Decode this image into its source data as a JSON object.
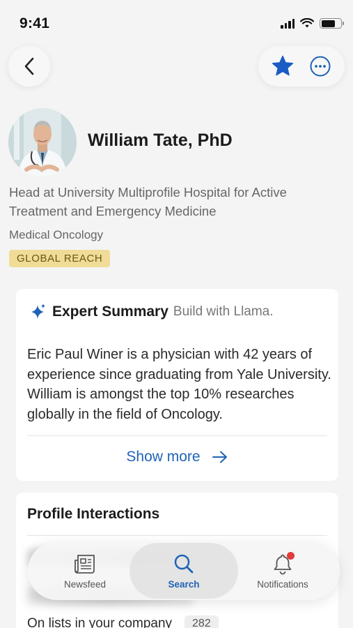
{
  "status_bar": {
    "time": "9:41"
  },
  "nav": {
    "back_icon": "chevron-left-icon",
    "favorite_icon": "star-icon",
    "more_icon": "ellipsis-circle-icon"
  },
  "profile": {
    "name": "William Tate, PhD",
    "title": "Head at University Multiprofile Hospital for Active Treatment and Emergency Medicine",
    "specialty": "Medical Oncology",
    "badge": "GLOBAL REACH"
  },
  "summary": {
    "title": "Expert Summary",
    "subtitle": "Build with Llama.",
    "text": "Eric Paul Winer is a physician with 42 years of experience since graduating from Yale University. William is amongst the top 10% researches globally in the field of Oncology.",
    "show_more": "Show more"
  },
  "interactions": {
    "title": "Profile Interactions",
    "lists_label": "On lists in your company",
    "lists_count": "282"
  },
  "tab_bar": {
    "tabs": [
      {
        "label": "Newsfeed",
        "icon": "newspaper-icon"
      },
      {
        "label": "Search",
        "icon": "search-icon"
      },
      {
        "label": "Notifications",
        "icon": "bell-icon"
      }
    ],
    "active": "Search"
  },
  "colors": {
    "accent": "#1f63b5",
    "star": "#1a5bc4",
    "badge_bg": "#f0dc96",
    "badge_text": "#6a5716",
    "notification_dot": "#e33a3a",
    "background": "#f4f4f4"
  }
}
